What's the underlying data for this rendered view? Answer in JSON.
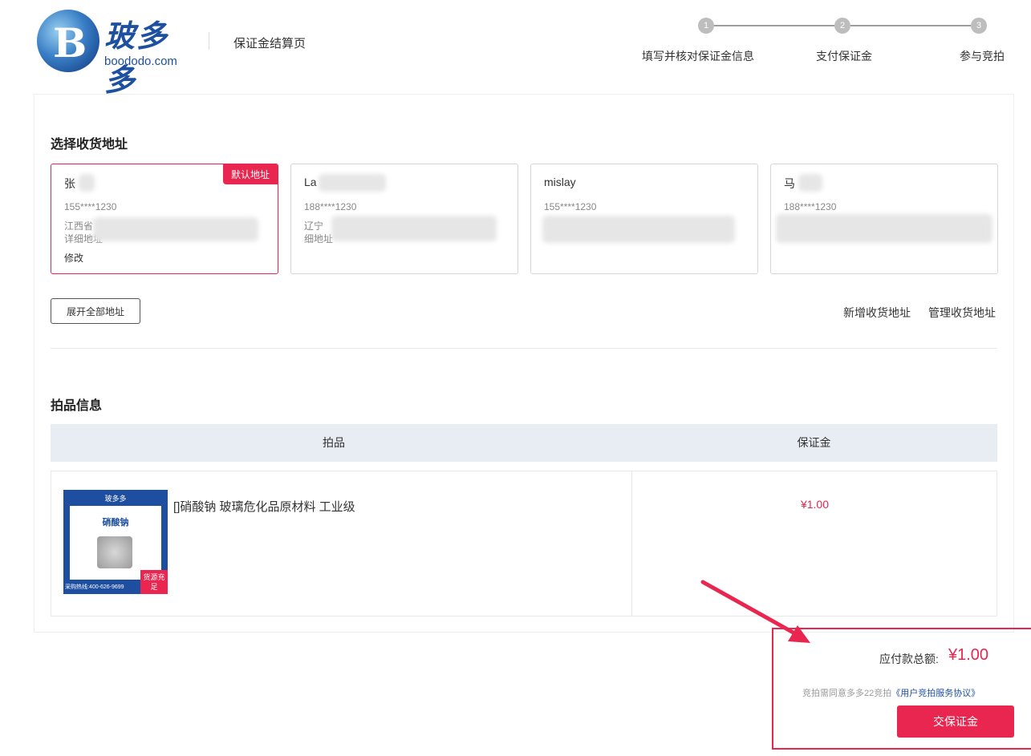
{
  "header": {
    "logo_cn": "玻多多",
    "logo_en": "boododo.com",
    "page_title": "保证金结算页"
  },
  "steps": [
    {
      "number": "1",
      "label": "填写并核对保证金信息"
    },
    {
      "number": "2",
      "label": "支付保证金"
    },
    {
      "number": "3",
      "label": "参与竞拍"
    }
  ],
  "address_section": {
    "title": "选择收货地址",
    "default_badge": "默认地址",
    "edit_label": "修改",
    "cards": [
      {
        "name": "张",
        "phone": "155****1230",
        "line1": "江西省",
        "line2": "详细地址"
      },
      {
        "name": "La",
        "phone": "188****1230",
        "line1": "辽宁",
        "line2": "细地址"
      },
      {
        "name": "mislay",
        "phone": "155****1230",
        "line1": "",
        "line2": ""
      },
      {
        "name": "马",
        "phone": "188****1230",
        "line1": "",
        "line2": ""
      }
    ],
    "expand_label": "展开全部地址",
    "add_label": "新增收货地址",
    "manage_label": "管理收货地址"
  },
  "product_section": {
    "title": "拍品信息",
    "col_item": "拍品",
    "col_deposit": "保证金",
    "product": {
      "title": "[]硝酸钠 玻璃危化品原材料 工业级",
      "image_name": "硝酸钠",
      "image_hotline": "采购热线:400-626-9699",
      "image_tag": "货源充足",
      "deposit": "¥1.00"
    }
  },
  "payment": {
    "total_label": "应付款总额:",
    "total_amount": "¥1.00",
    "agree_prefix": "竞拍需同意多多22竞拍",
    "agree_link": "《用户竞拍服务协议》",
    "button_label": "交保证金"
  },
  "colors": {
    "accent": "#e8264f",
    "brand_blue": "#1e50a0",
    "table_header_bg": "#e8edf3"
  }
}
